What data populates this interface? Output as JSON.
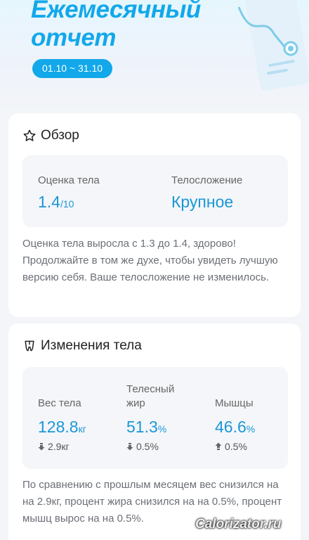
{
  "header": {
    "title": "Ежемесячный отчет",
    "date_range": "01.10 ~ 31.10"
  },
  "overview": {
    "title": "Обзор",
    "icon": "star-outline-icon",
    "score_label": "Оценка тела",
    "score_value": "1.4",
    "score_max": "/10",
    "build_label": "Телосложение",
    "build_value": "Крупное",
    "description": "Оценка тела выросла с 1.3 до 1.4, здорово! Продолжайте в том же духе, чтобы увидеть лучшую версию себя. Ваше телосложение не изменилось."
  },
  "body_changes": {
    "title": "Изменения тела",
    "icon": "body-figure-icon",
    "metrics": [
      {
        "label": "Вес тела",
        "value": "128.8",
        "unit": "кг",
        "change": "2.9кг",
        "direction": "down"
      },
      {
        "label": "Телесный жир",
        "value": "51.3",
        "unit": "%",
        "change": "0.5%",
        "direction": "down"
      },
      {
        "label": "Мышцы",
        "value": "46.6",
        "unit": "%",
        "change": "0.5%",
        "direction": "up"
      }
    ],
    "description": "По сравнению с прошлым месяцем вес снизился на на 2.9кг, процент жира снизился на на 0.5%, процент мышц вырос на на 0.5%."
  },
  "watermark": "Calorizator.ru",
  "colors": {
    "accent": "#12a8ea",
    "value": "#1a97d6",
    "background": "#f3f5f8"
  }
}
